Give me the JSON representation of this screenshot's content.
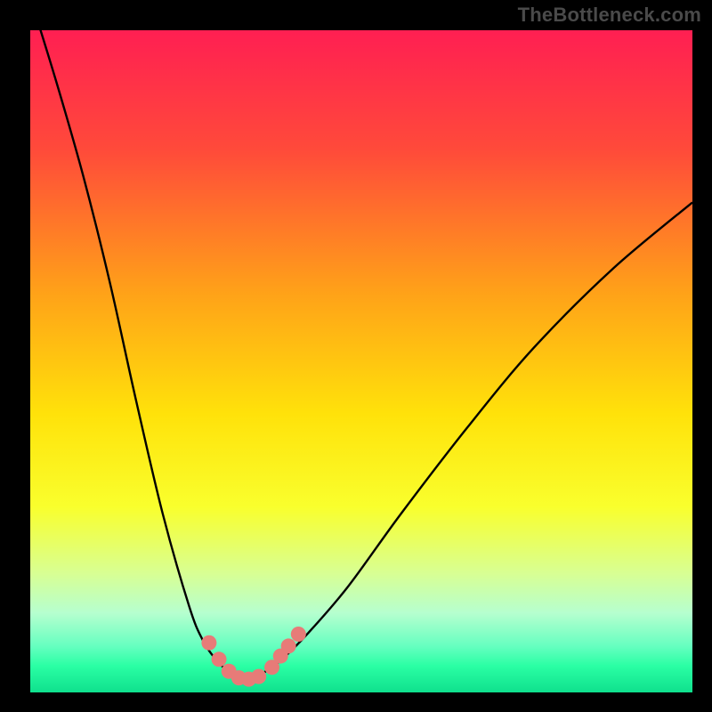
{
  "watermark": "TheBottleneck.com",
  "gradient": {
    "stops": [
      {
        "offset": "0%",
        "color": "#ff1f52"
      },
      {
        "offset": "18%",
        "color": "#ff4a3a"
      },
      {
        "offset": "40%",
        "color": "#ffa318"
      },
      {
        "offset": "58%",
        "color": "#ffe20a"
      },
      {
        "offset": "72%",
        "color": "#f9ff2d"
      },
      {
        "offset": "82%",
        "color": "#d8ff93"
      },
      {
        "offset": "88%",
        "color": "#b6ffcf"
      },
      {
        "offset": "93%",
        "color": "#66ffc0"
      },
      {
        "offset": "96%",
        "color": "#2affa4"
      },
      {
        "offset": "100%",
        "color": "#0fe08d"
      }
    ]
  },
  "marker_color": "#e77b78",
  "curve_color": "#000000",
  "chart_data": {
    "type": "line",
    "title": "",
    "xlabel": "",
    "ylabel": "",
    "xlim": [
      0,
      100
    ],
    "ylim": [
      0,
      100
    ],
    "x": [
      0,
      4,
      8,
      12,
      16,
      20,
      24,
      26,
      28,
      30,
      31,
      32,
      33,
      34,
      35,
      38,
      42,
      48,
      56,
      66,
      76,
      88,
      100
    ],
    "y": [
      105,
      92,
      78,
      62,
      44,
      27,
      13,
      8,
      5,
      3,
      2.2,
      2,
      2,
      2.2,
      2.8,
      5,
      9,
      16,
      27,
      40,
      52,
      64,
      74
    ],
    "markers": {
      "x": [
        27.0,
        28.5,
        30.0,
        31.5,
        33.0,
        34.5,
        36.5,
        37.8,
        39.0,
        40.5
      ],
      "y": [
        7.5,
        5.0,
        3.2,
        2.2,
        2.0,
        2.4,
        3.8,
        5.5,
        7.0,
        8.8
      ]
    },
    "note": "Values are in percent of plot area; the curve is a V-shaped bottleneck profile. No axis ticks or labels are shown in the image."
  }
}
